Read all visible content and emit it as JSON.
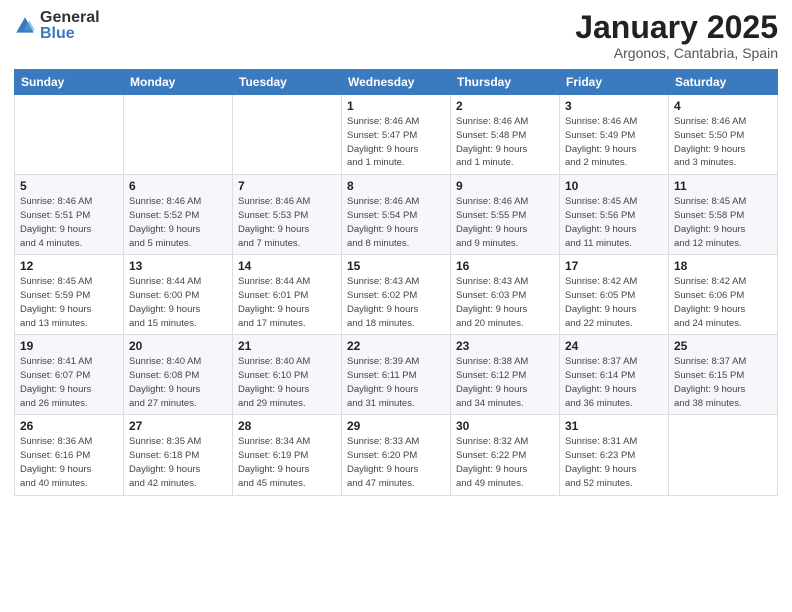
{
  "logo": {
    "general": "General",
    "blue": "Blue"
  },
  "header": {
    "month": "January 2025",
    "location": "Argonos, Cantabria, Spain"
  },
  "days_of_week": [
    "Sunday",
    "Monday",
    "Tuesday",
    "Wednesday",
    "Thursday",
    "Friday",
    "Saturday"
  ],
  "weeks": [
    [
      {
        "day": "",
        "info": ""
      },
      {
        "day": "",
        "info": ""
      },
      {
        "day": "",
        "info": ""
      },
      {
        "day": "1",
        "info": "Sunrise: 8:46 AM\nSunset: 5:47 PM\nDaylight: 9 hours\nand 1 minute."
      },
      {
        "day": "2",
        "info": "Sunrise: 8:46 AM\nSunset: 5:48 PM\nDaylight: 9 hours\nand 1 minute."
      },
      {
        "day": "3",
        "info": "Sunrise: 8:46 AM\nSunset: 5:49 PM\nDaylight: 9 hours\nand 2 minutes."
      },
      {
        "day": "4",
        "info": "Sunrise: 8:46 AM\nSunset: 5:50 PM\nDaylight: 9 hours\nand 3 minutes."
      }
    ],
    [
      {
        "day": "5",
        "info": "Sunrise: 8:46 AM\nSunset: 5:51 PM\nDaylight: 9 hours\nand 4 minutes."
      },
      {
        "day": "6",
        "info": "Sunrise: 8:46 AM\nSunset: 5:52 PM\nDaylight: 9 hours\nand 5 minutes."
      },
      {
        "day": "7",
        "info": "Sunrise: 8:46 AM\nSunset: 5:53 PM\nDaylight: 9 hours\nand 7 minutes."
      },
      {
        "day": "8",
        "info": "Sunrise: 8:46 AM\nSunset: 5:54 PM\nDaylight: 9 hours\nand 8 minutes."
      },
      {
        "day": "9",
        "info": "Sunrise: 8:46 AM\nSunset: 5:55 PM\nDaylight: 9 hours\nand 9 minutes."
      },
      {
        "day": "10",
        "info": "Sunrise: 8:45 AM\nSunset: 5:56 PM\nDaylight: 9 hours\nand 11 minutes."
      },
      {
        "day": "11",
        "info": "Sunrise: 8:45 AM\nSunset: 5:58 PM\nDaylight: 9 hours\nand 12 minutes."
      }
    ],
    [
      {
        "day": "12",
        "info": "Sunrise: 8:45 AM\nSunset: 5:59 PM\nDaylight: 9 hours\nand 13 minutes."
      },
      {
        "day": "13",
        "info": "Sunrise: 8:44 AM\nSunset: 6:00 PM\nDaylight: 9 hours\nand 15 minutes."
      },
      {
        "day": "14",
        "info": "Sunrise: 8:44 AM\nSunset: 6:01 PM\nDaylight: 9 hours\nand 17 minutes."
      },
      {
        "day": "15",
        "info": "Sunrise: 8:43 AM\nSunset: 6:02 PM\nDaylight: 9 hours\nand 18 minutes."
      },
      {
        "day": "16",
        "info": "Sunrise: 8:43 AM\nSunset: 6:03 PM\nDaylight: 9 hours\nand 20 minutes."
      },
      {
        "day": "17",
        "info": "Sunrise: 8:42 AM\nSunset: 6:05 PM\nDaylight: 9 hours\nand 22 minutes."
      },
      {
        "day": "18",
        "info": "Sunrise: 8:42 AM\nSunset: 6:06 PM\nDaylight: 9 hours\nand 24 minutes."
      }
    ],
    [
      {
        "day": "19",
        "info": "Sunrise: 8:41 AM\nSunset: 6:07 PM\nDaylight: 9 hours\nand 26 minutes."
      },
      {
        "day": "20",
        "info": "Sunrise: 8:40 AM\nSunset: 6:08 PM\nDaylight: 9 hours\nand 27 minutes."
      },
      {
        "day": "21",
        "info": "Sunrise: 8:40 AM\nSunset: 6:10 PM\nDaylight: 9 hours\nand 29 minutes."
      },
      {
        "day": "22",
        "info": "Sunrise: 8:39 AM\nSunset: 6:11 PM\nDaylight: 9 hours\nand 31 minutes."
      },
      {
        "day": "23",
        "info": "Sunrise: 8:38 AM\nSunset: 6:12 PM\nDaylight: 9 hours\nand 34 minutes."
      },
      {
        "day": "24",
        "info": "Sunrise: 8:37 AM\nSunset: 6:14 PM\nDaylight: 9 hours\nand 36 minutes."
      },
      {
        "day": "25",
        "info": "Sunrise: 8:37 AM\nSunset: 6:15 PM\nDaylight: 9 hours\nand 38 minutes."
      }
    ],
    [
      {
        "day": "26",
        "info": "Sunrise: 8:36 AM\nSunset: 6:16 PM\nDaylight: 9 hours\nand 40 minutes."
      },
      {
        "day": "27",
        "info": "Sunrise: 8:35 AM\nSunset: 6:18 PM\nDaylight: 9 hours\nand 42 minutes."
      },
      {
        "day": "28",
        "info": "Sunrise: 8:34 AM\nSunset: 6:19 PM\nDaylight: 9 hours\nand 45 minutes."
      },
      {
        "day": "29",
        "info": "Sunrise: 8:33 AM\nSunset: 6:20 PM\nDaylight: 9 hours\nand 47 minutes."
      },
      {
        "day": "30",
        "info": "Sunrise: 8:32 AM\nSunset: 6:22 PM\nDaylight: 9 hours\nand 49 minutes."
      },
      {
        "day": "31",
        "info": "Sunrise: 8:31 AM\nSunset: 6:23 PM\nDaylight: 9 hours\nand 52 minutes."
      },
      {
        "day": "",
        "info": ""
      }
    ]
  ]
}
